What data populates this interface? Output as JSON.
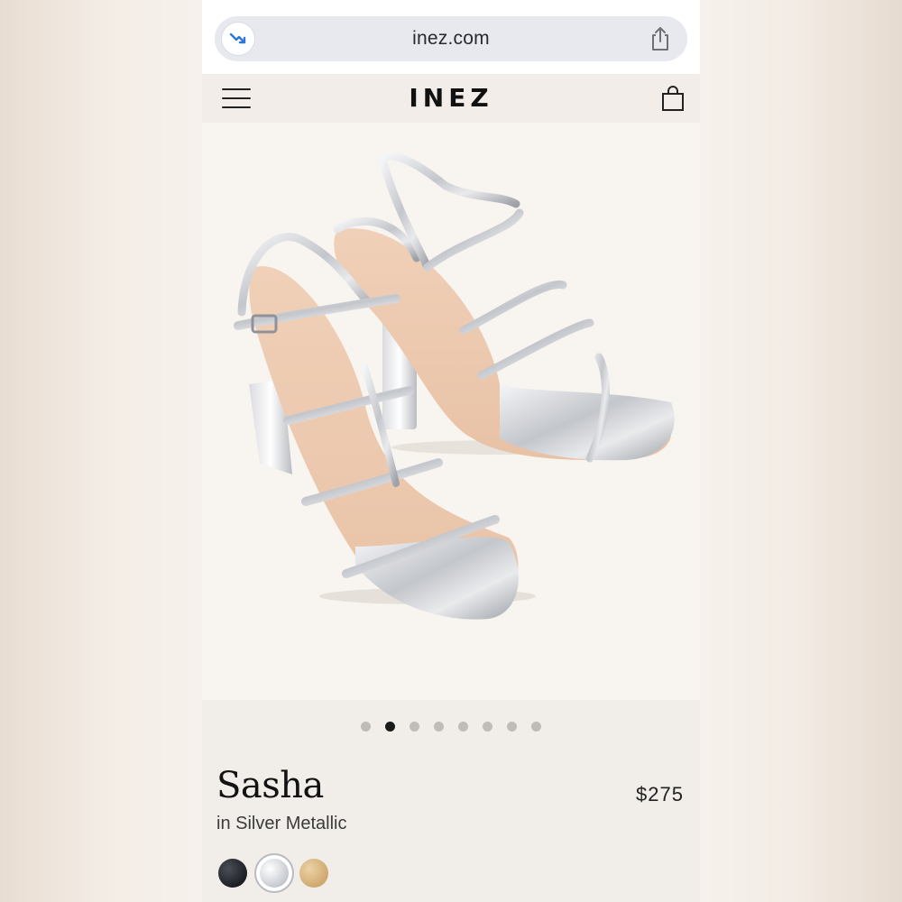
{
  "browser": {
    "url": "inez.com",
    "site_icon": "trend-down-icon",
    "share_icon": "share-icon"
  },
  "header": {
    "brand": "INEZ",
    "menu_icon": "hamburger-menu-icon",
    "cart_icon": "shopping-bag-icon"
  },
  "gallery": {
    "image": "silver metallic strappy block-heel sandals",
    "dot_count": 8,
    "active_index": 1
  },
  "product": {
    "name": "Sasha",
    "price": "$275",
    "color_label": "in Silver Metallic",
    "swatches": [
      {
        "name": "black",
        "color": "#1c1f24",
        "selected": false
      },
      {
        "name": "silver",
        "color": "#c6cad0",
        "selected": true
      },
      {
        "name": "tan",
        "color": "#cda56c",
        "selected": false
      }
    ]
  },
  "colors": {
    "background": "#f1ede8",
    "url_field": "#e7e9ee",
    "accent_icon": "#2f78d9"
  }
}
